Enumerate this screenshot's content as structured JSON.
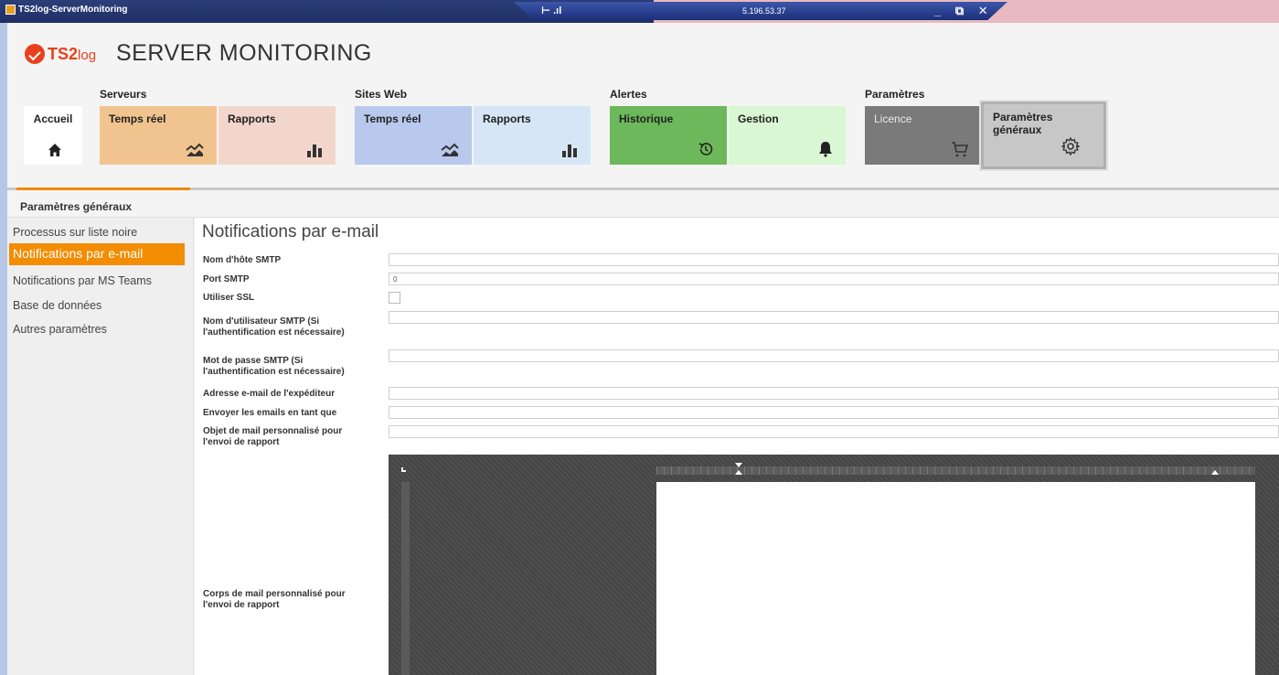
{
  "window": {
    "title": "TS2log-ServerMonitoring",
    "rdp_ip": "5.196.53.37",
    "rdp_controls": "_ ⧉ ✕",
    "rdp_pin": "⊢ .ıl"
  },
  "header": {
    "brand": "TS2",
    "brand_suffix": "log",
    "title": "SERVER MONITORING"
  },
  "groups": {
    "serveurs": "Serveurs",
    "sites_web": "Sites Web",
    "alertes": "Alertes",
    "parametres": "Paramètres"
  },
  "tiles": {
    "accueil": "Accueil",
    "srv_temps_reel": "Temps réel",
    "srv_rapports": "Rapports",
    "web_temps_reel": "Temps réel",
    "web_rapports": "Rapports",
    "historique": "Historique",
    "gestion": "Gestion",
    "licence": "Licence",
    "parametres_generaux": "Paramètres généraux"
  },
  "colors": {
    "accent": "#f28c00",
    "serveurs_realtime": "#f1c48f",
    "serveurs_reports": "#f2d6cb",
    "web_realtime": "#b9c9ee",
    "web_reports": "#d6e6f6",
    "historique": "#6cb85a",
    "gestion": "#d9f7d2",
    "licence": "#7a7a7a",
    "parametres": "#c7c7c7"
  },
  "section": {
    "title": "Paramètres généraux"
  },
  "sidenav": {
    "items": [
      "Processus sur liste noire",
      "Notifications par e-mail",
      "Notifications par MS Teams",
      "Base de données",
      "Autres paramètres"
    ],
    "active_index": 1
  },
  "form": {
    "title": "Notifications par e-mail",
    "smtp_host_label": "Nom d'hôte SMTP",
    "smtp_host_value": "",
    "smtp_port_label": "Port SMTP",
    "smtp_port_value": "0",
    "ssl_label": "Utiliser SSL",
    "ssl_checked": false,
    "smtp_user_label": "Nom d'utilisateur SMTP (Si l'authentification est nécessaire)",
    "smtp_user_value": "",
    "smtp_pass_label": "Mot de passe SMTP (Si l'authentification est nécessaire)",
    "smtp_pass_value": "",
    "sender_label": "Adresse e-mail de l'expéditeur",
    "sender_value": "",
    "send_as_label": "Envoyer les emails en tant que",
    "send_as_value": "",
    "subject_label": "Objet de mail personnalisé pour l'envoi de rapport",
    "subject_value": "",
    "body_label": "Corps de mail personnalisé pour l'envoi de rapport"
  }
}
